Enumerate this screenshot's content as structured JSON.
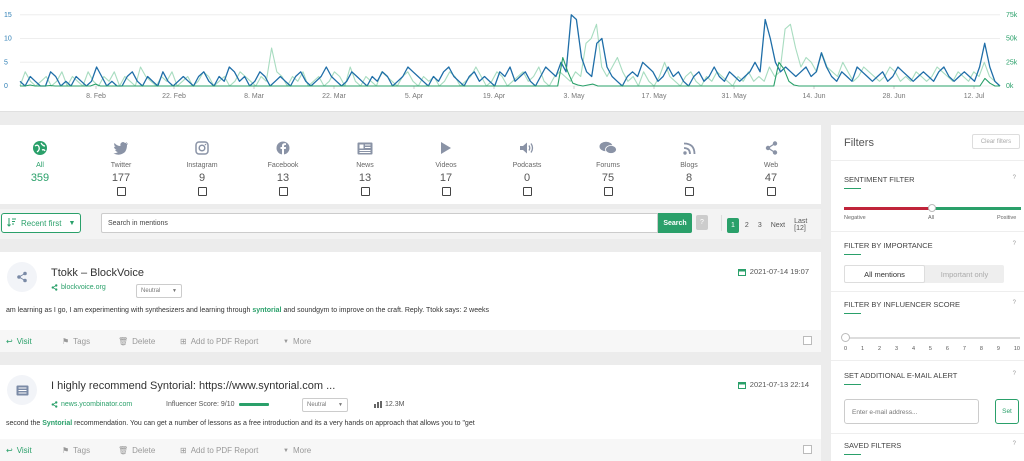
{
  "chart_data": {
    "type": "line",
    "x_ticks": [
      "8. Feb",
      "22. Feb",
      "8. Mar",
      "22. Mar",
      "5. Apr",
      "19. Apr",
      "3. May",
      "17. May",
      "31. May",
      "14. Jun",
      "28. Jun",
      "12. Jul"
    ],
    "y_left_ticks": [
      "0",
      "5",
      "10",
      "15"
    ],
    "y_right_ticks": [
      "0k",
      "25k",
      "50k",
      "75k"
    ],
    "ylim_left": [
      0,
      16
    ],
    "ylim_right": [
      0,
      80000
    ],
    "grid": true,
    "series": [
      {
        "axis": "left",
        "color": "#1f6ea8",
        "values": [
          1,
          0,
          2,
          1,
          0,
          0,
          3,
          2,
          0,
          1,
          0,
          2,
          1,
          0,
          1,
          4,
          2,
          0,
          1,
          0,
          0,
          2,
          3,
          1,
          0,
          2,
          1,
          0,
          3,
          1,
          0,
          1,
          2,
          1,
          0,
          2,
          3,
          1,
          0,
          2,
          1,
          4,
          3,
          1,
          2,
          0,
          1,
          3,
          2,
          0,
          1,
          2,
          1,
          0,
          2,
          3,
          1,
          0,
          1,
          2,
          4,
          2,
          1,
          0,
          1,
          3,
          2,
          1,
          0,
          2,
          1,
          3,
          2,
          0,
          1,
          2,
          4,
          3,
          2,
          1,
          0,
          2,
          1,
          3,
          4,
          2,
          1,
          0,
          2,
          3,
          1,
          2,
          1,
          0,
          3,
          2,
          4,
          1,
          2,
          3,
          1,
          0,
          2,
          4,
          3,
          2,
          5,
          3,
          15,
          14,
          6,
          3,
          2,
          9,
          10,
          4,
          2,
          1,
          0,
          2,
          3,
          2,
          5,
          4,
          3,
          1,
          2,
          4,
          2,
          3,
          1,
          0,
          2,
          3,
          1,
          2,
          4,
          2,
          1,
          3,
          2,
          1,
          2,
          3,
          5,
          3,
          14,
          10,
          5,
          3,
          4,
          3,
          2,
          3,
          4,
          2,
          3,
          7,
          4,
          2,
          1,
          3,
          2,
          1,
          4,
          3,
          2,
          1,
          2,
          3,
          1,
          2,
          4,
          3,
          2,
          1,
          2,
          3,
          2,
          1,
          3,
          4,
          2,
          1,
          2,
          3,
          2,
          1,
          4,
          9,
          4,
          1,
          0
        ]
      },
      {
        "axis": "left",
        "color": "#a8dcc0",
        "values": [
          0,
          3,
          1,
          0,
          1,
          2,
          0,
          1,
          3,
          0,
          2,
          1,
          0,
          3,
          1,
          0,
          2,
          1,
          3,
          0,
          2,
          1,
          0,
          4,
          2,
          1,
          0,
          2,
          1,
          3,
          0,
          1,
          2,
          0,
          1,
          3,
          2,
          0,
          1,
          2,
          0,
          1,
          3,
          2,
          1,
          0,
          2,
          1,
          8,
          3,
          2,
          0,
          2,
          1,
          3,
          0,
          1,
          2,
          0,
          1,
          3,
          2,
          0,
          4,
          1,
          0,
          2,
          1,
          0,
          3,
          2,
          1,
          0,
          2,
          3,
          1,
          0,
          2,
          1,
          2,
          0,
          1,
          3,
          2,
          0,
          1,
          2,
          4,
          2,
          0,
          1,
          3,
          2,
          0,
          1,
          2,
          3,
          1,
          2,
          4,
          1,
          0,
          2,
          3,
          2,
          1,
          3,
          2,
          9,
          10,
          13,
          4,
          2,
          4,
          6,
          3,
          1,
          2,
          0,
          3,
          1,
          0,
          2,
          5,
          2,
          1,
          0,
          2,
          3,
          1,
          0,
          2,
          1,
          3,
          2,
          1,
          0,
          2,
          1,
          3,
          1,
          2,
          1,
          4,
          2,
          3,
          12,
          13,
          8,
          4,
          6,
          5,
          3,
          7,
          4,
          3,
          2,
          5,
          3,
          1,
          2,
          4,
          3,
          2,
          1,
          2,
          4,
          3,
          1,
          2,
          1,
          3,
          2,
          1,
          2,
          4,
          3,
          2,
          1,
          3,
          2,
          1,
          3,
          2,
          5,
          2,
          1,
          0
        ]
      },
      {
        "axis": "right",
        "color": "#2aa06a",
        "values": [
          0,
          0,
          1000,
          0,
          0,
          0,
          500,
          0,
          0,
          0,
          0,
          0,
          0,
          0,
          0,
          2000,
          0,
          0,
          0,
          0,
          0,
          0,
          0,
          0,
          0,
          0,
          0,
          0,
          0,
          0,
          0,
          0,
          0,
          0,
          0,
          0,
          0,
          0,
          0,
          0,
          0,
          0,
          0,
          0,
          0,
          0,
          0,
          0,
          0,
          0,
          0,
          0,
          0,
          0,
          0,
          0,
          0,
          0,
          0,
          0,
          0,
          0,
          0,
          0,
          0,
          0,
          0,
          0,
          0,
          0,
          0,
          0,
          0,
          0,
          0,
          0,
          0,
          0,
          0,
          0,
          0,
          0,
          0,
          0,
          0,
          0,
          0,
          0,
          0,
          0,
          0,
          0,
          0,
          0,
          0,
          0,
          0,
          0,
          0,
          0,
          0,
          0,
          0,
          0,
          0,
          0,
          0,
          0,
          30000,
          15000,
          3000,
          1000,
          0,
          1000,
          2000,
          0,
          0,
          0,
          0,
          0,
          0,
          0,
          0,
          0,
          0,
          0,
          0,
          0,
          0,
          0,
          0,
          0,
          0,
          0,
          0,
          0,
          0,
          0,
          0,
          0,
          0,
          0,
          0,
          0,
          0,
          0,
          0,
          0,
          0,
          0,
          0,
          25000,
          18000,
          5000,
          1000,
          0,
          0,
          0,
          0,
          0,
          0,
          0,
          0,
          0,
          0,
          0,
          0,
          0,
          0,
          0,
          0,
          0,
          0,
          0,
          0,
          0,
          0,
          0,
          0,
          0,
          0,
          0,
          0,
          0,
          0,
          0,
          0,
          0,
          0,
          0,
          0,
          0,
          8000,
          3000,
          0,
          0
        ]
      }
    ]
  },
  "channels": [
    {
      "key": "all",
      "name": "All",
      "count": "359",
      "icon": "globe-icon",
      "active": true
    },
    {
      "key": "twitter",
      "name": "Twitter",
      "count": "177",
      "icon": "twitter-icon"
    },
    {
      "key": "instagram",
      "name": "Instagram",
      "count": "9",
      "icon": "instagram-icon"
    },
    {
      "key": "facebook",
      "name": "Facebook",
      "count": "13",
      "icon": "facebook-icon"
    },
    {
      "key": "news",
      "name": "News",
      "count": "13",
      "icon": "news-icon"
    },
    {
      "key": "videos",
      "name": "Videos",
      "count": "17",
      "icon": "play-icon"
    },
    {
      "key": "podcasts",
      "name": "Podcasts",
      "count": "0",
      "icon": "speaker-icon"
    },
    {
      "key": "forums",
      "name": "Forums",
      "count": "75",
      "icon": "chat-icon"
    },
    {
      "key": "blogs",
      "name": "Blogs",
      "count": "8",
      "icon": "rss-icon"
    },
    {
      "key": "web",
      "name": "Web",
      "count": "47",
      "icon": "share-icon"
    }
  ],
  "toolbar": {
    "sort_label": "Recent first",
    "search_placeholder": "Search in mentions",
    "search_button": "Search",
    "help": "?",
    "pages": [
      "1",
      "2",
      "3"
    ],
    "next": "Next",
    "last": "Last [12]"
  },
  "mentions": [
    {
      "title": "Ttokk – BlockVoice",
      "source": "blockvoice.org",
      "sentiment": "Neutral",
      "date": "2021-07-14 19:07",
      "text_before": "am learning as I go, I am experimenting with synthesizers and learning through ",
      "highlight": "syntorial",
      "text_after": " and soundgym to improve on the craft. Reply. Ttokk says: 2 weeks"
    },
    {
      "title": "I highly recommend Syntorial: https://www.syntorial.com ...",
      "source": "news.ycombinator.com",
      "influencer_label": "Influencer Score: 9/10",
      "sentiment": "Neutral",
      "reach": "12.3M",
      "date": "2021-07-13 22:14",
      "text_before": "second the ",
      "highlight": "Syntorial",
      "text_after": " recommendation. You can get a number of lessons as a free introduction and its a very hands on approach that allows you to \"get"
    }
  ],
  "actions": {
    "visit": "Visit",
    "tags": "Tags",
    "delete": "Delete",
    "pdf": "Add to PDF Report",
    "more": "More"
  },
  "filters": {
    "title": "Filters",
    "clear": "Clear filters",
    "sentiment": {
      "heading": "SENTIMENT FILTER",
      "negative": "Negative",
      "all": "All",
      "positive": "Positive"
    },
    "importance": {
      "heading": "FILTER BY IMPORTANCE",
      "all": "All mentions",
      "important": "Important only"
    },
    "influencer": {
      "heading": "FILTER BY INFLUENCER SCORE",
      "ticks": [
        "0",
        "1",
        "2",
        "3",
        "4",
        "5",
        "6",
        "7",
        "8",
        "9",
        "10"
      ]
    },
    "email": {
      "heading": "SET ADDITIONAL E-MAIL ALERT",
      "placeholder": "Enter e-mail address...",
      "button": "Set"
    },
    "saved": {
      "heading": "SAVED FILTERS"
    },
    "help": "?"
  },
  "colors": {
    "accent": "#2aa06a",
    "blue": "#1f6ea8",
    "light_green": "#a8dcc0",
    "negative": "#c0243a"
  }
}
